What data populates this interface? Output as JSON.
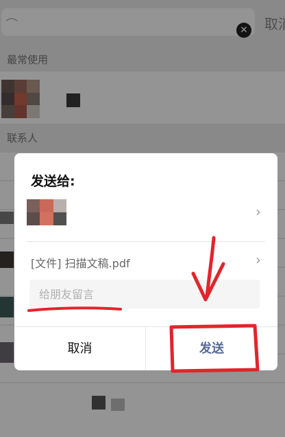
{
  "search": {
    "clear_icon": "clear-icon",
    "cancel_label": "取消"
  },
  "sections": {
    "recent": "最常使用",
    "contacts": "联系人"
  },
  "dialog": {
    "title": "发送给:",
    "file_label": "[文件] 扫描文稿.pdf",
    "message_placeholder": "给朋友留言",
    "cancel_label": "取消",
    "send_label": "发送",
    "chevron_icon": "chevron-right-icon"
  },
  "colors": {
    "send": "#576b95",
    "annotation": "#e3242b",
    "overlay": "rgba(0,0,0,0.42)"
  }
}
